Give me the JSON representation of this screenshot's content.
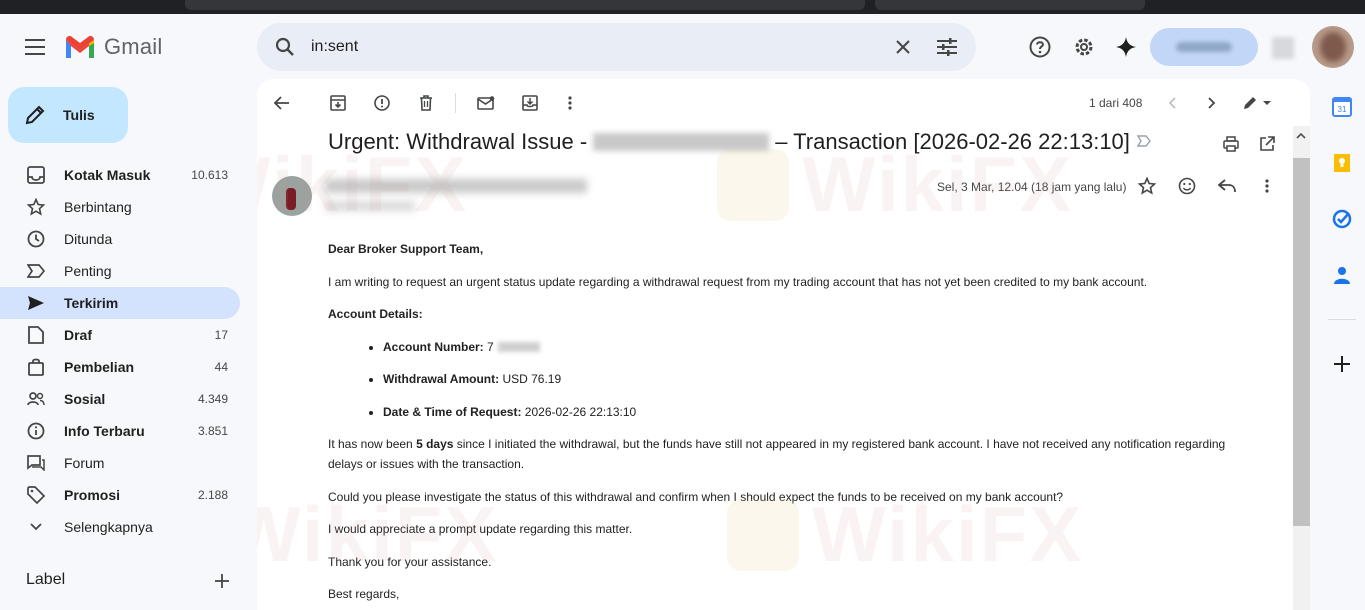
{
  "app": {
    "name": "Gmail"
  },
  "search": {
    "query": "in:sent"
  },
  "compose": {
    "label": "Tulis"
  },
  "nav": [
    {
      "label": "Kotak Masuk",
      "count": "10.613",
      "bold": true,
      "icon": "inbox-icon"
    },
    {
      "label": "Berbintang",
      "count": "",
      "bold": false,
      "icon": "star-icon"
    },
    {
      "label": "Ditunda",
      "count": "",
      "bold": false,
      "icon": "clock-icon"
    },
    {
      "label": "Penting",
      "count": "",
      "bold": false,
      "icon": "label-important-icon"
    },
    {
      "label": "Terkirim",
      "count": "",
      "bold": true,
      "active": true,
      "icon": "send-icon"
    },
    {
      "label": "Draf",
      "count": "17",
      "bold": true,
      "icon": "draft-icon"
    },
    {
      "label": "Pembelian",
      "count": "44",
      "bold": true,
      "icon": "shopping-bag-icon"
    },
    {
      "label": "Sosial",
      "count": "4.349",
      "bold": true,
      "icon": "people-icon"
    },
    {
      "label": "Info Terbaru",
      "count": "3.851",
      "bold": true,
      "icon": "info-icon"
    },
    {
      "label": "Forum",
      "count": "",
      "bold": false,
      "icon": "forum-icon"
    },
    {
      "label": "Promosi",
      "count": "2.188",
      "bold": true,
      "icon": "tag-icon"
    },
    {
      "label": "Selengkapnya",
      "count": "",
      "bold": false,
      "icon": "chevron-down-icon"
    }
  ],
  "labels_section": {
    "title": "Label"
  },
  "pager": {
    "text": "1 dari 408"
  },
  "message": {
    "subject_prefix": "Urgent: Withdrawal Issue -",
    "subject_suffix": "– Transaction [2026-02-26 22:13:10]",
    "date": "Sel, 3 Mar, 12.04 (18 jam yang lalu)",
    "greeting": "Dear Broker Support Team,",
    "intro": "I am writing to request an urgent status update regarding a withdrawal request from my trading account that has not yet been credited to my bank account.",
    "details_heading": "Account Details:",
    "detail_account_label": "Account Number:",
    "detail_account_value": "7",
    "detail_amount_label": "Withdrawal Amount:",
    "detail_amount_value": " USD 76.19",
    "detail_date_label": "Date & Time of Request:",
    "detail_date_value": " 2026-02-26 22:13:10",
    "para1_a": "It has now been ",
    "para1_bold": "5 days",
    "para1_b": " since I initiated the withdrawal, but the funds have still not appeared in my registered bank account. I have not received any notification regarding delays or issues with the transaction.",
    "para2": "Could you please investigate the status of this withdrawal and confirm when I should expect the funds to be received on my bank account?",
    "para3": "I would appreciate a prompt update regarding this matter.",
    "para4": "Thank you for your assistance.",
    "closing": "Best regards,"
  },
  "watermark": {
    "text": "WikiFX"
  },
  "colors": {
    "accent": "#0b57d0",
    "active_nav": "#d3e3fd",
    "compose": "#c2e7ff",
    "background": "#f6f8fc"
  }
}
